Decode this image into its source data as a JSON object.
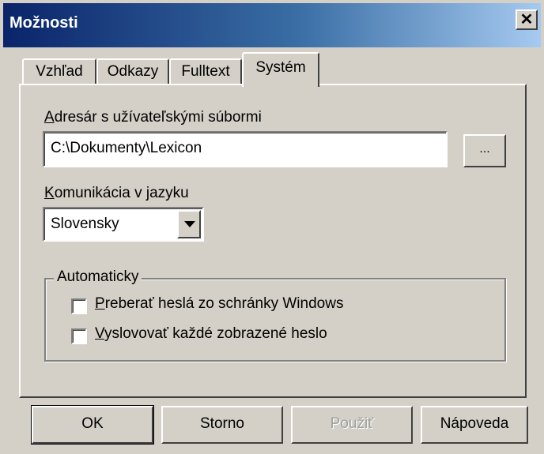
{
  "window": {
    "title": "Možnosti",
    "close_glyph": "✕"
  },
  "tabs": [
    {
      "label": "Vzhľad",
      "active": false
    },
    {
      "label": "Odkazy",
      "active": false
    },
    {
      "label": "Fulltext",
      "active": false
    },
    {
      "label": "Systém",
      "active": true
    }
  ],
  "system": {
    "folder_label_accel": "A",
    "folder_label_rest": "dresár s užívateľskými súbormi",
    "folder_value": "C:\\Dokumenty\\Lexicon",
    "browse_label": "...",
    "language_label_accel": "K",
    "language_label_rest": "omunikácia v jazyku",
    "language_value": "Slovensky",
    "group_title": "Automaticky",
    "checkbox1_accel": "P",
    "checkbox1_rest": "reberať heslá zo schránky Windows",
    "checkbox1_checked": false,
    "checkbox2_accel": "V",
    "checkbox2_rest": "yslovovať každé zobrazené heslo",
    "checkbox2_checked": false
  },
  "buttons": {
    "ok": "OK",
    "cancel": "Storno",
    "apply": "Použiť",
    "help": "Nápoveda"
  }
}
